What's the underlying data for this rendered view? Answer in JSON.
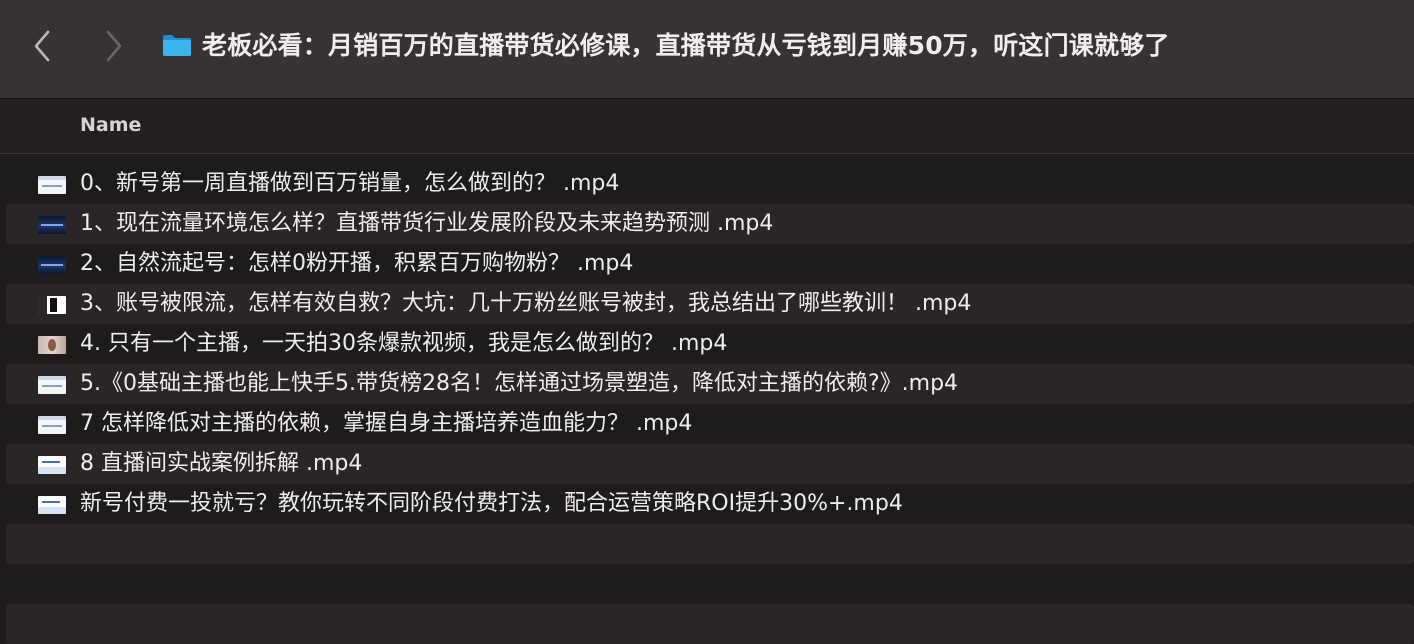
{
  "window": {
    "title": "老板必看：月销百万的直播带货必修课，直播带货从亏钱到月赚50万，听这门课就够了"
  },
  "toolbar": {
    "back_icon": "chevron-left-icon",
    "forward_icon": "chevron-right-icon",
    "folder_icon": "folder-icon",
    "folder_color": "#2ea8e0"
  },
  "columns": {
    "name": "Name"
  },
  "files": [
    {
      "name": "0、新号第一周直播做到百万销量，怎么做到的？ .mp4",
      "thumb": "light"
    },
    {
      "name": "1、现在流量环境怎么样？直播带货行业发展阶段及未来趋势预测 .mp4",
      "thumb": "dark"
    },
    {
      "name": "2、自然流起号：怎样0粉开播，积累百万购物粉？ .mp4",
      "thumb": "dark"
    },
    {
      "name": "3、账号被限流，怎样有效自救？大坑：几十万粉丝账号被封，我总结出了哪些教训！ .mp4",
      "thumb": "phone"
    },
    {
      "name": "4. 只有一个主播，一天拍30条爆款视频，我是怎么做到的？ .mp4",
      "thumb": "face"
    },
    {
      "name": "5.《0基础主播也能上快手5.带货榜28名！怎样通过场景塑造，降低对主播的依赖?》.mp4",
      "thumb": "light"
    },
    {
      "name": "7 怎样降低对主播的依赖，掌握自身主播培养造血能力？ .mp4",
      "thumb": "light"
    },
    {
      "name": "8 直播间实战案例拆解 .mp4",
      "thumb": "whiteblue"
    },
    {
      "name": "新号付费一投就亏？教你玩转不同阶段付费打法，配合运营策略ROI提升30%+.mp4",
      "thumb": "whiteblue"
    }
  ]
}
